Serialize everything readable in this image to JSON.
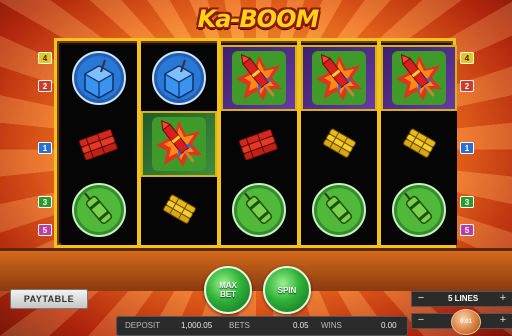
{
  "game": {
    "title": "Ka-BOOM"
  },
  "line_markers": {
    "left": [
      {
        "label": "4",
        "color": "#e8c51a"
      },
      {
        "label": "2",
        "color": "#d23a2a"
      },
      {
        "label": "1",
        "color": "#2a6fd6"
      },
      {
        "label": "3",
        "color": "#2a9a2a"
      },
      {
        "label": "5",
        "color": "#c03aa0"
      }
    ],
    "right": [
      {
        "label": "4",
        "color": "#e8c51a"
      },
      {
        "label": "2",
        "color": "#d23a2a"
      },
      {
        "label": "1",
        "color": "#2a6fd6"
      },
      {
        "label": "3",
        "color": "#2a9a2a"
      },
      {
        "label": "5",
        "color": "#c03aa0"
      }
    ]
  },
  "reels": [
    [
      "firecracker-box",
      "dynamite-bundle",
      "dynamite-tube"
    ],
    [
      "firecracker-box",
      "rocket",
      "fuse-bundle"
    ],
    [
      "rocket",
      "dynamite-bundle",
      "dynamite-tube"
    ],
    [
      "rocket",
      "fuse-bundle",
      "dynamite-tube"
    ],
    [
      "rocket",
      "fuse-bundle",
      "dynamite-tube"
    ]
  ],
  "controls": {
    "paytable_label": "PAYTABLE",
    "max_bet_label": "MAX BET",
    "spin_label": "SPIN",
    "lines_label": "5 LINES",
    "minus_label": "−",
    "plus_label": "+",
    "coin_value": "0.01"
  },
  "info": {
    "deposit_label": "DEPOSIT",
    "deposit_value": "1,000.05",
    "bets_label": "BETS",
    "bets_value": "0.05",
    "wins_label": "WINS",
    "wins_value": "0.00"
  },
  "colors": {
    "frame": "#f5c317",
    "button_green": "#2fb23a"
  }
}
